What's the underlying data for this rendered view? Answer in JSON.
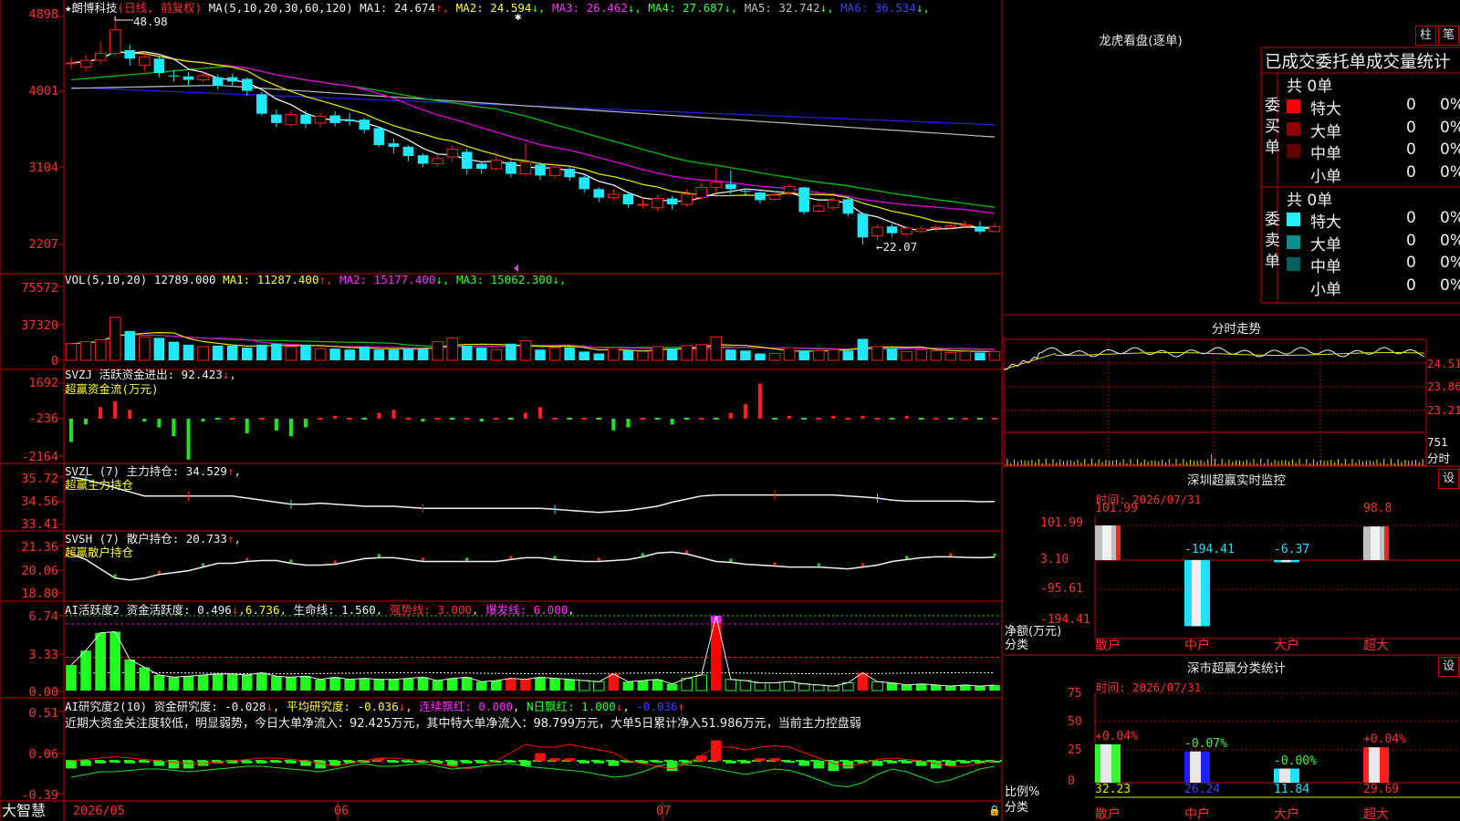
{
  "stock": {
    "star": "★",
    "name": "朗博科技",
    "period": "(日线, 前复权)"
  },
  "ma_line": {
    "label": "MA(5,10,20,30,60,120)",
    "items": [
      {
        "text": "MA1: 24.674",
        "arrow": "↑",
        "color": "#f0f0f0"
      },
      {
        "text": "MA2: 24.594",
        "arrow": "↓",
        "color": "#ffff30"
      },
      {
        "text": "MA3: 26.462",
        "arrow": "↓",
        "color": "#ff30ff"
      },
      {
        "text": "MA4: 27.687",
        "arrow": "↓",
        "color": "#30ff30"
      },
      {
        "text": "MA5: 32.742",
        "arrow": "↓",
        "color": "#c0c0c0"
      },
      {
        "text": "MA6: 36.534",
        "arrow": "↓",
        "color": "#4040ff"
      }
    ]
  },
  "price_axis": [
    "4898",
    "4001",
    "3104",
    "2207"
  ],
  "price_annotations": {
    "high": "48.98",
    "low": "22.07"
  },
  "vol_line": {
    "label": "VOL(5,10,20)",
    "value": "12789.000",
    "items": [
      {
        "text": "MA1: 11287.400",
        "arrow": "↑",
        "color": "#ffff30"
      },
      {
        "text": "MA2: 15177.400",
        "arrow": "↓",
        "color": "#ff30ff"
      },
      {
        "text": "MA3: 15062.300",
        "arrow": "↓",
        "color": "#30ff30"
      }
    ]
  },
  "vol_axis": [
    "75572",
    "37320",
    "0"
  ],
  "svzj": {
    "label": "SVZJ  活跃资金进出: 92.423",
    "arrow": "↓",
    "sub": "超赢资金流(万元)",
    "axis": [
      "1692",
      "-236",
      "-2164"
    ]
  },
  "svzl": {
    "label": "SVZL (7) 主力持仓: 34.529",
    "arrow": "↑",
    "sub": "超赢主力持仓",
    "axis": [
      "35.72",
      "34.56",
      "33.41"
    ]
  },
  "svsh": {
    "label": "SVSH (7) 散户持仓: 20.733",
    "arrow": "↑",
    "sub": "超赢散户持仓",
    "axis": [
      "21.36",
      "20.06",
      "18.80"
    ]
  },
  "ai_active": {
    "label": "AI活跃度2",
    "t1": "资金活跃度: 0.496",
    "a1": "↓",
    "t2": "6.736",
    "t3": "生命线: 1.560",
    "t4": "强势线: 3.000",
    "t5": "爆发线: 6.000",
    "axis": [
      "6.74",
      "3.33",
      "0.00"
    ]
  },
  "ai_research": {
    "label": "AI研究度2(10)",
    "t1": "资金研究度: -0.028",
    "a1": "↓",
    "t2": "平均研究度: -0.036",
    "a2": "↓",
    "t3": "连续飘红: 0.000",
    "t4": "N日飘红: 1.000",
    "a4": "↓",
    "t5": "-0.036",
    "a5": "↑",
    "comment": "近期大资金关注度较低，明显弱势，今日大单净流入：92.425万元，其中特大单净流入：98.799万元，大单5日累计净入51.986万元，当前主力控盘弱",
    "axis": [
      "0.51",
      "0.06",
      "-0.39"
    ]
  },
  "bottom": {
    "brand": "大智慧",
    "dates": [
      "2026/05",
      "06",
      "07"
    ]
  },
  "dragon": {
    "title": "龙虎看盘(逐单)",
    "btn1": "柱",
    "btn2": "笔",
    "header": "已成交委托单成交量统计",
    "buy": {
      "side": "委买单",
      "total": "共 0单",
      "rows": [
        {
          "name": "特大",
          "count": "0",
          "pct": "0%",
          "color": "#ff0000"
        },
        {
          "name": "大单",
          "count": "0",
          "pct": "0%",
          "color": "#900000"
        },
        {
          "name": "中单",
          "count": "0",
          "pct": "0%",
          "color": "#600000"
        },
        {
          "name": "小单",
          "count": "0",
          "pct": "0%",
          "color": ""
        }
      ]
    },
    "sell": {
      "side": "委卖单",
      "total": "共 0单",
      "rows": [
        {
          "name": "特大",
          "count": "0",
          "pct": "0%",
          "color": "#20f0ff"
        },
        {
          "name": "大单",
          "count": "0",
          "pct": "0%",
          "color": "#009090"
        },
        {
          "name": "中单",
          "count": "0",
          "pct": "0%",
          "color": "#006060"
        },
        {
          "name": "小单",
          "count": "0",
          "pct": "0%",
          "color": ""
        }
      ]
    }
  },
  "intraday": {
    "title": "分时走势",
    "axis": [
      "24.51",
      "23.86",
      "23.21"
    ],
    "vol": "751",
    "unit": "分时"
  },
  "sz_monitor": {
    "title": "深圳超赢实时监控",
    "btn": "设",
    "time": "时间: 2026/07/31",
    "axis": [
      "101.99",
      "3.10",
      "-95.61",
      "-194.41"
    ],
    "ylabel1": "净额(万元)",
    "ylabel2": "分类",
    "cats": [
      "散户",
      "中户",
      "大户",
      "超大"
    ],
    "values": [
      "101.99",
      "-194.41",
      "-6.37",
      "98.8"
    ]
  },
  "sz_class": {
    "title": "深市超赢分类统计",
    "btn": "设",
    "time": "时间: 2026/07/31",
    "axis": [
      "75",
      "50",
      "25",
      "0"
    ],
    "ylabel1": "比例%",
    "ylabel2": "分类",
    "cats": [
      "散户",
      "中户",
      "大户",
      "超大"
    ],
    "changes": [
      "+0.04%",
      "-0.07%",
      "-0.00%",
      "+0.04%"
    ],
    "values": [
      "32.23",
      "26.24",
      "11.84",
      "29.69"
    ]
  },
  "chart_data": {
    "type": "candlestick",
    "candles": [
      [
        43.5,
        43.5,
        44.2,
        42.8
      ],
      [
        43.0,
        43.8,
        44.5,
        42.5
      ],
      [
        43.8,
        44.6,
        46.0,
        43.4
      ],
      [
        44.6,
        47.4,
        48.98,
        44.3
      ],
      [
        45.0,
        44.0,
        45.6,
        43.2
      ],
      [
        43.2,
        44.2,
        44.8,
        42.6
      ],
      [
        44.0,
        42.3,
        44.3,
        41.8
      ],
      [
        42.0,
        41.9,
        42.6,
        41.3
      ],
      [
        41.9,
        41.5,
        42.4,
        40.9
      ],
      [
        41.5,
        42.0,
        42.5,
        41.2
      ],
      [
        41.8,
        40.8,
        42.1,
        40.4
      ],
      [
        41.8,
        41.3,
        42.2,
        40.8
      ],
      [
        41.6,
        40.2,
        41.8,
        39.6
      ],
      [
        39.8,
        37.5,
        40.1,
        37.3
      ],
      [
        37.4,
        36.4,
        38.0,
        35.9
      ],
      [
        36.2,
        37.4,
        37.8,
        35.9
      ],
      [
        37.4,
        36.3,
        37.9,
        35.8
      ],
      [
        36.4,
        37.2,
        37.6,
        35.9
      ],
      [
        37.3,
        36.4,
        37.8,
        36.0
      ],
      [
        36.8,
        36.6,
        37.6,
        36.1
      ],
      [
        36.8,
        35.6,
        37.0,
        35.2
      ],
      [
        35.8,
        33.8,
        36.0,
        33.6
      ],
      [
        34.0,
        33.6,
        34.6,
        32.8
      ],
      [
        33.6,
        32.5,
        33.8,
        31.9
      ],
      [
        32.6,
        31.6,
        32.8,
        31.2
      ],
      [
        31.6,
        32.2,
        32.6,
        31.3
      ],
      [
        32.4,
        33.3,
        33.8,
        31.8
      ],
      [
        33.0,
        31.0,
        33.4,
        30.3
      ],
      [
        31.6,
        31.0,
        31.9,
        30.4
      ],
      [
        31.0,
        32.0,
        33.0,
        30.8
      ],
      [
        31.8,
        30.4,
        32.3,
        30.0
      ],
      [
        30.4,
        31.8,
        34.0,
        30.1
      ],
      [
        31.5,
        30.2,
        31.8,
        29.7
      ],
      [
        30.2,
        31.2,
        31.6,
        29.9
      ],
      [
        31.0,
        30.0,
        31.3,
        29.6
      ],
      [
        30.0,
        28.6,
        30.2,
        28.2
      ],
      [
        28.6,
        27.6,
        28.8,
        27.1
      ],
      [
        27.6,
        28.0,
        28.6,
        27.3
      ],
      [
        28.0,
        26.8,
        28.2,
        26.4
      ],
      [
        26.8,
        26.8,
        27.6,
        26.3
      ],
      [
        26.4,
        27.5,
        27.9,
        26.1
      ],
      [
        27.5,
        26.8,
        27.8,
        26.2
      ],
      [
        26.8,
        28.0,
        28.6,
        26.5
      ],
      [
        27.6,
        28.8,
        29.3,
        27.4
      ],
      [
        28.8,
        29.4,
        31.2,
        28.2
      ],
      [
        29.2,
        28.6,
        30.8,
        28.0
      ],
      [
        28.4,
        28.3,
        28.7,
        27.8
      ],
      [
        28.2,
        27.3,
        28.4,
        26.9
      ],
      [
        27.4,
        27.9,
        28.3,
        27.2
      ],
      [
        28.2,
        28.9,
        29.2,
        27.8
      ],
      [
        28.8,
        25.9,
        28.9,
        25.6
      ],
      [
        26.0,
        26.6,
        27.0,
        25.8
      ],
      [
        26.4,
        27.3,
        27.6,
        26.1
      ],
      [
        27.4,
        25.7,
        27.8,
        25.4
      ],
      [
        25.7,
        22.9,
        25.9,
        22.07
      ],
      [
        23.1,
        24.1,
        24.4,
        22.6
      ],
      [
        24.2,
        23.4,
        24.5,
        23.0
      ],
      [
        23.3,
        24.0,
        24.2,
        23.0
      ],
      [
        23.6,
        23.9,
        24.3,
        23.4
      ],
      [
        24.0,
        24.1,
        24.4,
        23.6
      ],
      [
        24.1,
        24.3,
        24.6,
        23.8
      ],
      [
        24.4,
        24.4,
        24.9,
        24.0
      ],
      [
        24.2,
        23.6,
        24.8,
        23.3
      ],
      [
        23.6,
        24.2,
        24.6,
        23.5
      ]
    ]
  }
}
